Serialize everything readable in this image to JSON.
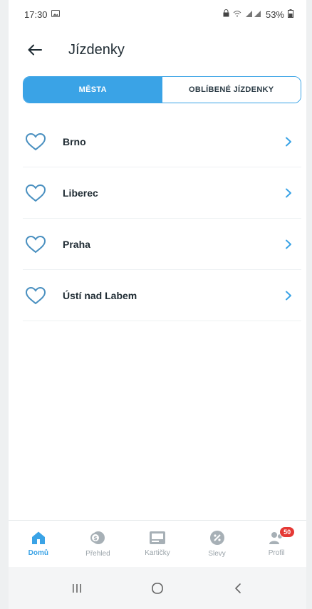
{
  "status_bar": {
    "time": "17:30",
    "battery": "53%"
  },
  "header": {
    "title": "Jízdenky"
  },
  "tabs": [
    {
      "label": "MĚSTA",
      "active": true
    },
    {
      "label": "OBLÍBENÉ JÍZDENKY",
      "active": false
    }
  ],
  "cities": [
    "Brno",
    "Liberec",
    "Praha",
    "Ústí nad Labem"
  ],
  "bottom_nav": [
    {
      "label": "Domů",
      "icon": "home-icon",
      "active": true
    },
    {
      "label": "Přehled",
      "icon": "overview-icon",
      "active": false
    },
    {
      "label": "Kartičky",
      "icon": "cards-icon",
      "active": false
    },
    {
      "label": "Slevy",
      "icon": "discount-icon",
      "active": false
    },
    {
      "label": "Profil",
      "icon": "profile-icon",
      "active": false,
      "badge": "50"
    }
  ],
  "colors": {
    "accent": "#3aa3e6",
    "heart": "#4a90c0",
    "badge": "#e53935"
  }
}
